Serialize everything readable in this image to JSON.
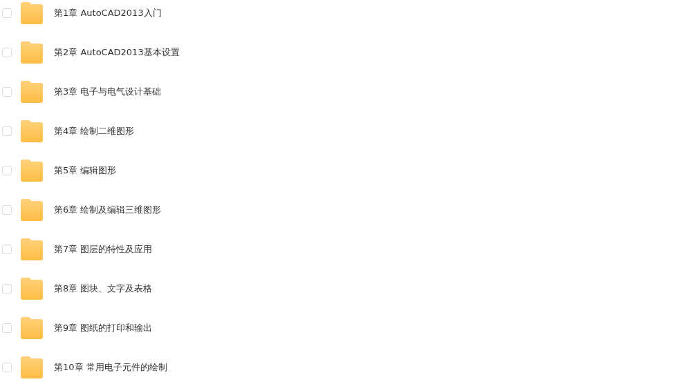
{
  "folders": [
    {
      "name": "第1章 AutoCAD2013入门",
      "checked": false
    },
    {
      "name": "第2章 AutoCAD2013基本设置",
      "checked": false
    },
    {
      "name": "第3章 电子与电气设计基础",
      "checked": false
    },
    {
      "name": "第4章 绘制二维图形",
      "checked": false
    },
    {
      "name": "第5章 编辑图形",
      "checked": false
    },
    {
      "name": "第6章 绘制及编辑三维图形",
      "checked": false
    },
    {
      "name": "第7章 图层的特性及应用",
      "checked": false
    },
    {
      "name": "第8章 图块、文字及表格",
      "checked": false
    },
    {
      "name": "第9章 图纸的打印和输出",
      "checked": false
    },
    {
      "name": "第10章 常用电子元件的绘制",
      "checked": false
    }
  ]
}
